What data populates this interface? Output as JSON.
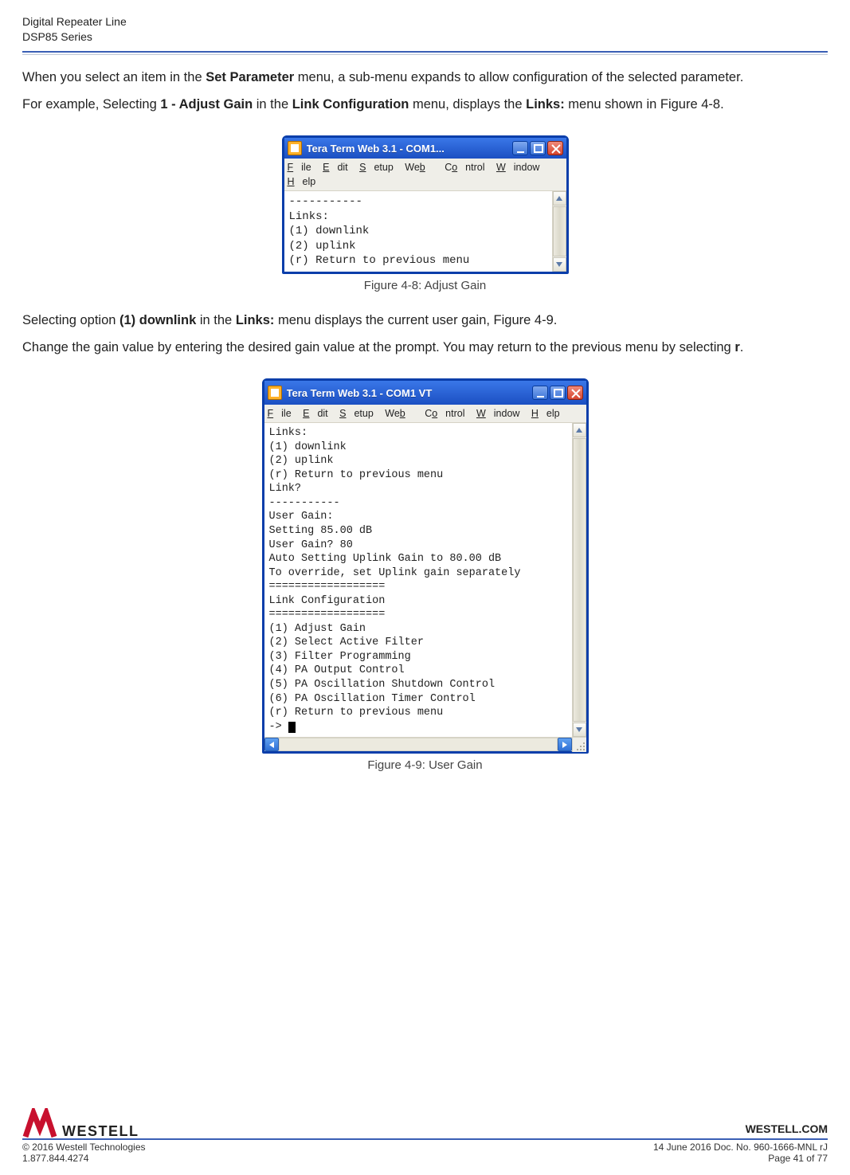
{
  "header": {
    "line1": "Digital Repeater Line",
    "line2": "DSP85 Series"
  },
  "para1": {
    "pre": "When you select an item in the ",
    "b1": "Set Parameter",
    "post": " menu, a sub-menu expands to allow configuration of the selected parameter."
  },
  "para2": {
    "p1": "For example, Selecting ",
    "b1": "1 - Adjust Gain",
    "p2": " in the ",
    "b2": "Link Configuration",
    "p3": " menu, displays the ",
    "b3": "Links:",
    "p4": " menu shown in Figure 4-8."
  },
  "fig1": {
    "title": "Tera Term Web 3.1 - COM1...",
    "menus": {
      "file": "File",
      "edit": "Edit",
      "setup": "Setup",
      "web": "Web",
      "control": "Control",
      "window": "Window",
      "help": "Help"
    },
    "content": "-----------\nLinks:\n(1) downlink\n(2) uplink\n(r) Return to previous menu",
    "caption": "Figure 4-8: Adjust Gain"
  },
  "para3": {
    "p1": "Selecting option ",
    "b1": "(1) downlink",
    "p2": " in the ",
    "b2": "Links:",
    "p3": " menu displays the current user gain, Figure 4-9."
  },
  "para4": {
    "p1": "Change the gain value by entering the desired gain value at the prompt.  You may return to the previous menu by selecting ",
    "b1": "r",
    "p2": "."
  },
  "fig2": {
    "title": "Tera Term Web 3.1 - COM1 VT",
    "menus": {
      "file": "File",
      "edit": "Edit",
      "setup": "Setup",
      "web": "Web",
      "control": "Control",
      "window": "Window",
      "help": "Help"
    },
    "content": "Links:\n(1) downlink\n(2) uplink\n(r) Return to previous menu\nLink?\n-----------\nUser Gain:\nSetting 85.00 dB\nUser Gain? 80\nAuto Setting Uplink Gain to 80.00 dB\nTo override, set Uplink gain separately\n==================\nLink Configuration\n==================\n(1) Adjust Gain\n(2) Select Active Filter\n(3) Filter Programming\n(4) PA Output Control\n(5) PA Oscillation Shutdown Control\n(6) PA Oscillation Timer Control\n(r) Return to previous menu\n-> ",
    "caption": "Figure 4-9: User Gain"
  },
  "footer": {
    "brand": "WESTELL",
    "site": "WESTELL.COM",
    "copyright": "© 2016 Westell Technologies",
    "phone": "1.877.844.4274",
    "docline": "14 June 2016 Doc. No. 960-1666-MNL rJ",
    "pageline": "Page 41 of 77"
  }
}
